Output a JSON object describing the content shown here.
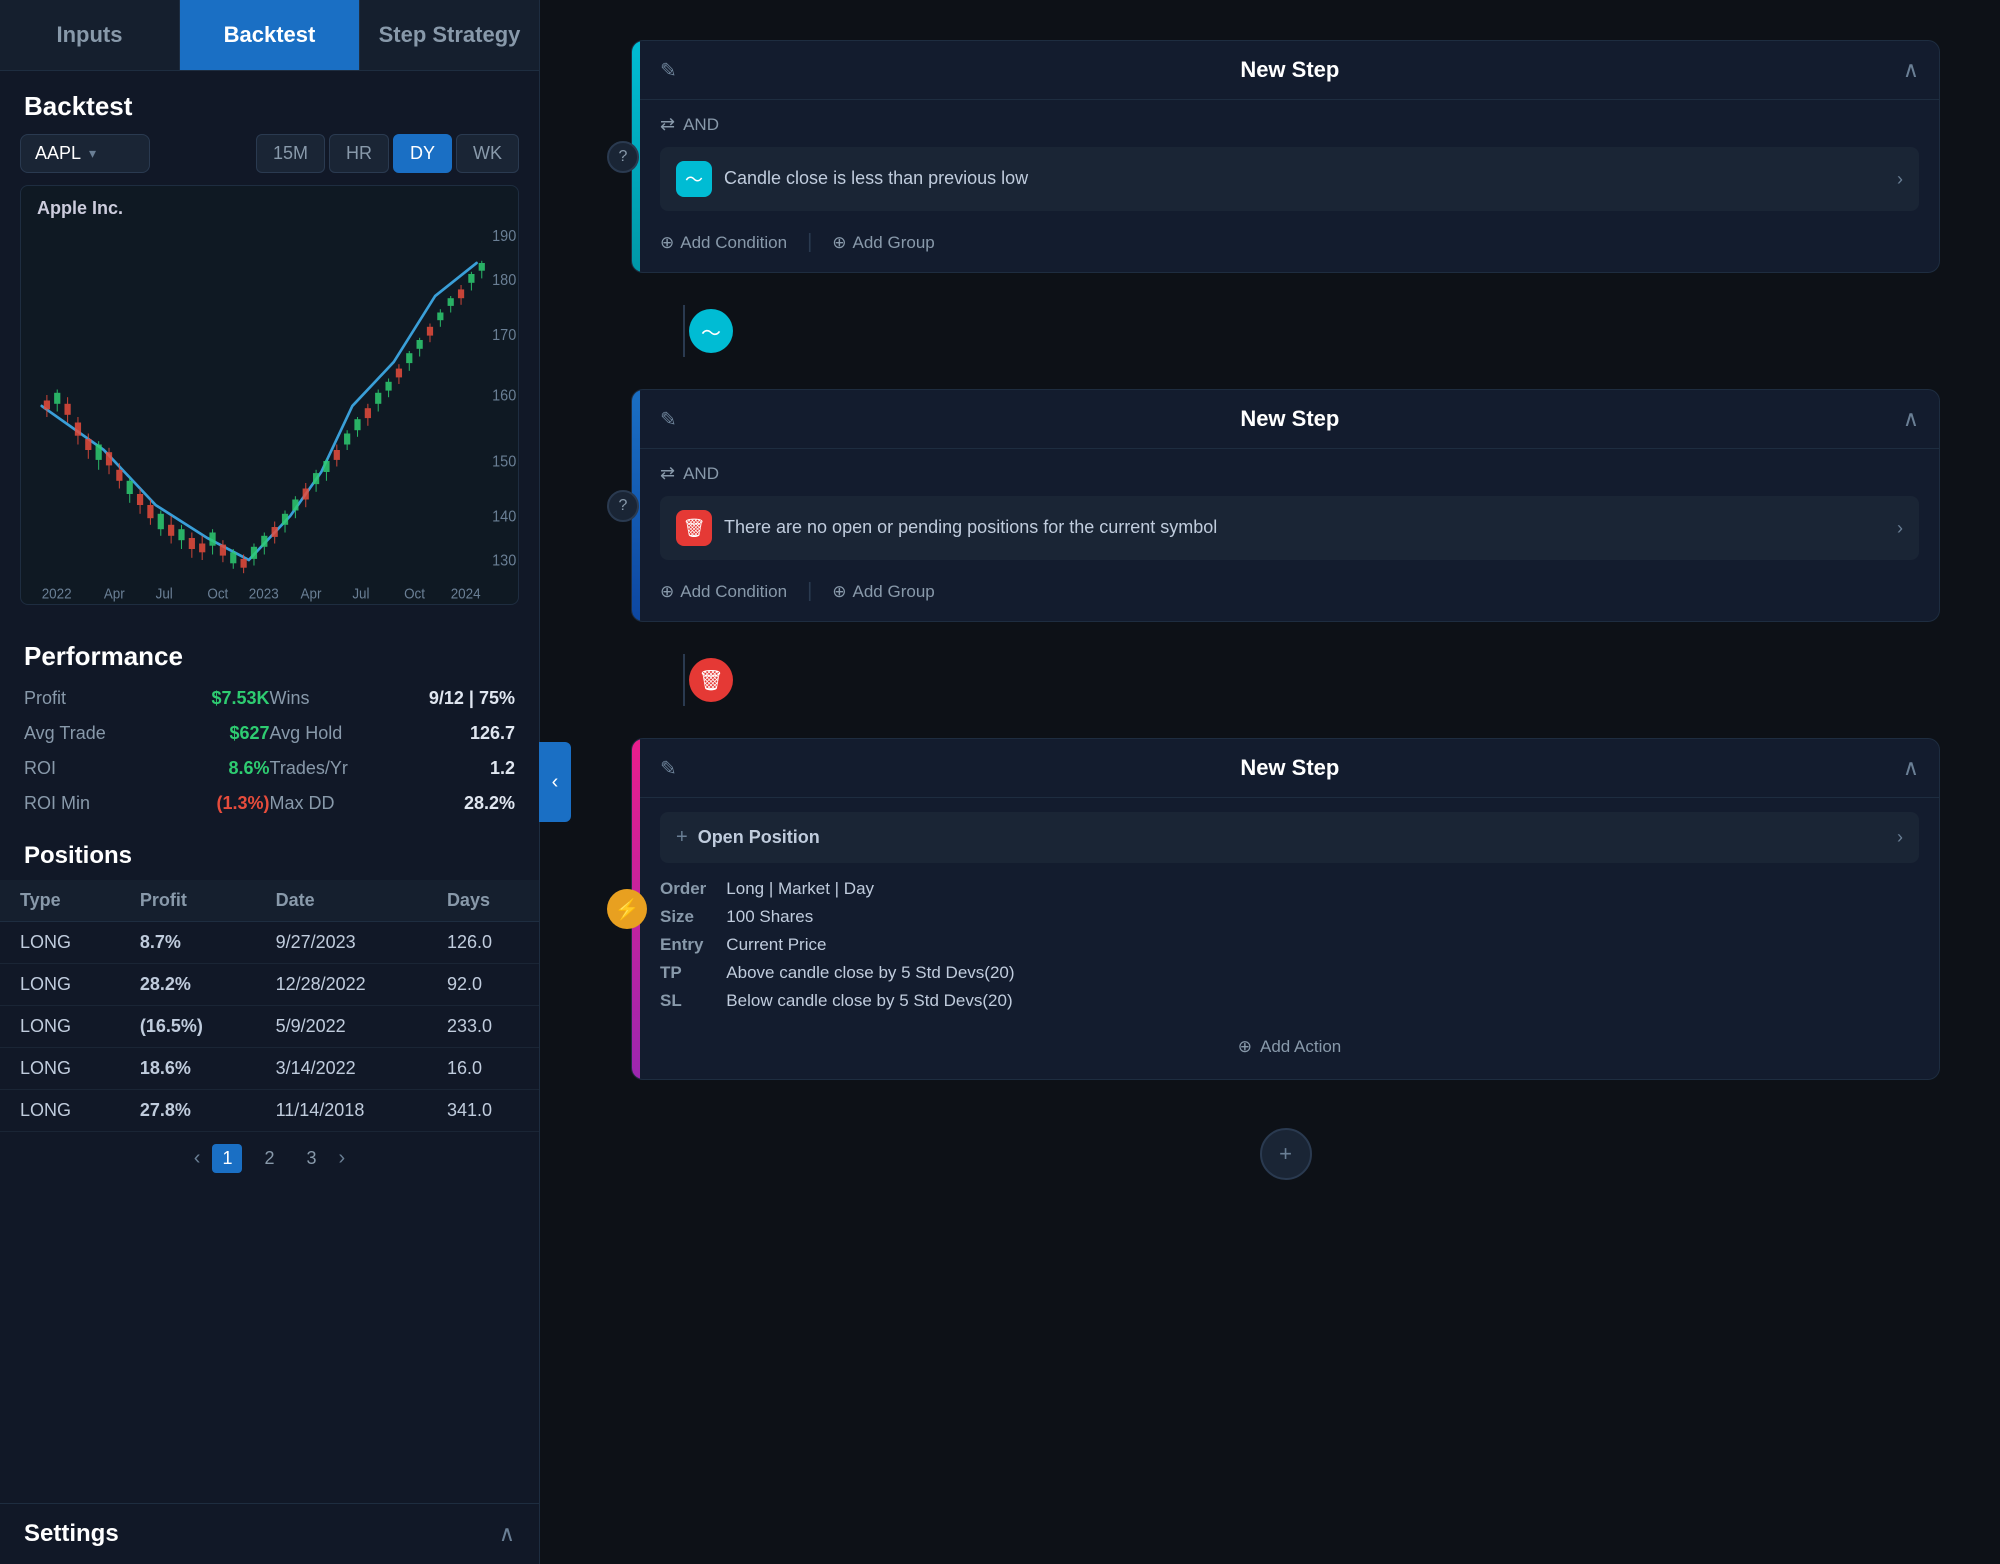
{
  "tabs": [
    {
      "label": "Inputs",
      "id": "inputs",
      "active": false
    },
    {
      "label": "Backtest",
      "id": "backtest",
      "active": true
    },
    {
      "label": "Step Strategy",
      "id": "step-strategy",
      "active": false
    }
  ],
  "backtest": {
    "section_label": "Backtest",
    "symbol": "AAPL",
    "symbol_name": "Apple Inc.",
    "timeframes": [
      "15M",
      "HR",
      "DY",
      "WK"
    ],
    "active_tf": "DY"
  },
  "performance": {
    "section_label": "Performance",
    "rows": [
      {
        "label": "Profit",
        "value": "$7.53K",
        "type": "positive"
      },
      {
        "label": "Wins",
        "value": "9/12 | 75%",
        "type": "neutral"
      },
      {
        "label": "Avg Trade",
        "value": "$627",
        "type": "positive"
      },
      {
        "label": "Avg Hold",
        "value": "126.7",
        "type": "neutral"
      },
      {
        "label": "ROI",
        "value": "8.6%",
        "type": "positive"
      },
      {
        "label": "Trades/Yr",
        "value": "1.2",
        "type": "neutral"
      },
      {
        "label": "ROI Min",
        "value": "(1.3%)",
        "type": "negative"
      },
      {
        "label": "Max DD",
        "value": "28.2%",
        "type": "neutral"
      }
    ]
  },
  "positions": {
    "section_label": "Positions",
    "columns": [
      "Type",
      "Profit",
      "Date",
      "Days"
    ],
    "rows": [
      {
        "type": "LONG",
        "profit": "8.7%",
        "profit_type": "positive",
        "date": "9/27/2023",
        "days": "126.0"
      },
      {
        "type": "LONG",
        "profit": "28.2%",
        "profit_type": "positive",
        "date": "12/28/2022",
        "days": "92.0"
      },
      {
        "type": "LONG",
        "profit": "(16.5%)",
        "profit_type": "negative",
        "date": "5/9/2022",
        "days": "233.0"
      },
      {
        "type": "LONG",
        "profit": "18.6%",
        "profit_type": "positive",
        "date": "3/14/2022",
        "days": "16.0"
      },
      {
        "type": "LONG",
        "profit": "27.8%",
        "profit_type": "positive",
        "date": "11/14/2018",
        "days": "341.0"
      }
    ],
    "pagination": [
      "1",
      "2",
      "3"
    ]
  },
  "settings": {
    "label": "Settings"
  },
  "right_panel": {
    "title": "Step Strategy",
    "steps": [
      {
        "id": "step1",
        "title": "New Step",
        "accent": "teal",
        "and_label": "AND",
        "conditions": [
          {
            "icon_type": "teal",
            "icon_char": "〜",
            "text": "Candle close is less than previous low"
          }
        ],
        "add_condition": "Add Condition",
        "add_group": "Add Group",
        "node_type": "teal",
        "node_char": "〜"
      },
      {
        "id": "step2",
        "title": "New Step",
        "accent": "blue",
        "and_label": "AND",
        "conditions": [
          {
            "icon_type": "red",
            "icon_char": "🗑",
            "text": "There are no open or pending positions for the current symbol"
          }
        ],
        "add_condition": "Add Condition",
        "add_group": "Add Group",
        "node_type": "red",
        "node_char": "🗑"
      },
      {
        "id": "step3",
        "title": "New Step",
        "accent": "pink",
        "action_label": "Open Position",
        "order_label": "Order",
        "order_value": "Long | Market | Day",
        "size_label": "Size",
        "size_value": "100 Shares",
        "entry_label": "Entry",
        "entry_value": "Current Price",
        "tp_label": "TP",
        "tp_value": "Above candle close by 5 Std Devs(20)",
        "sl_label": "SL",
        "sl_value": "Below candle close by 5 Std Devs(20)",
        "add_action": "Add Action",
        "node_type": "bolt",
        "node_char": "⚡"
      }
    ]
  }
}
